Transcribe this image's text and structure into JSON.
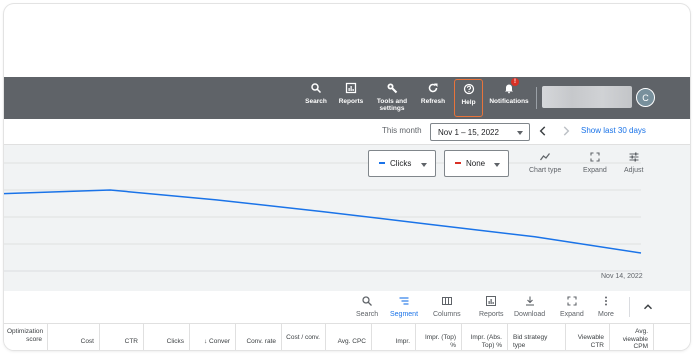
{
  "topbar": {
    "items": [
      {
        "label": "Search",
        "icon": "search-icon"
      },
      {
        "label": "Reports",
        "icon": "reports-icon"
      },
      {
        "label": "Tools and settings",
        "icon": "wrench-icon"
      },
      {
        "label": "Refresh",
        "icon": "refresh-icon"
      },
      {
        "label": "Help",
        "icon": "help-icon"
      },
      {
        "label": "Notifications",
        "icon": "bell-icon"
      }
    ],
    "notification_badge": "!",
    "avatar_initial": "C"
  },
  "daterange": {
    "preset_label": "This month",
    "range": "Nov 1 – 15, 2022",
    "show_last": "Show last 30 days"
  },
  "chart": {
    "metric1": "Clicks",
    "metric1_color": "#1a73e8",
    "metric2": "None",
    "metric2_color": "#d93025",
    "tools": [
      {
        "label": "Chart type",
        "icon": "line-chart-icon"
      },
      {
        "label": "Expand",
        "icon": "expand-icon"
      },
      {
        "label": "Adjust",
        "icon": "adjust-icon"
      }
    ],
    "end_date_label": "Nov 14, 2022"
  },
  "chart_data": {
    "type": "line",
    "series": [
      {
        "values": [
          0.86,
          0.9,
          0.79,
          0.66,
          0.52,
          0.38,
          0.2
        ]
      }
    ],
    "x_end_label": "Nov 14, 2022",
    "ylim": [
      0,
      1.2
    ],
    "grid": true
  },
  "table_tools": [
    {
      "label": "Search",
      "icon": "search-icon",
      "active": false
    },
    {
      "label": "Segment",
      "icon": "segment-icon",
      "active": true
    },
    {
      "label": "Columns",
      "icon": "columns-icon",
      "active": false
    },
    {
      "label": "Reports",
      "icon": "reports-icon",
      "active": false
    },
    {
      "label": "Download",
      "icon": "download-icon",
      "active": false
    },
    {
      "label": "Expand",
      "icon": "expand-icon",
      "active": false
    },
    {
      "label": "More",
      "icon": "more-vert-icon",
      "active": false
    }
  ],
  "table": {
    "columns": [
      "Optimization score",
      "Cost",
      "CTR",
      "Clicks",
      "↓ Conver",
      "Conv. rate",
      "Cost / conv.",
      "Avg. CPC",
      "Impr.",
      "Impr. (Top) %",
      "Impr. (Abs. Top) %",
      "Bid strategy type",
      "Viewable CTR",
      "Avg. viewable CPM"
    ]
  }
}
